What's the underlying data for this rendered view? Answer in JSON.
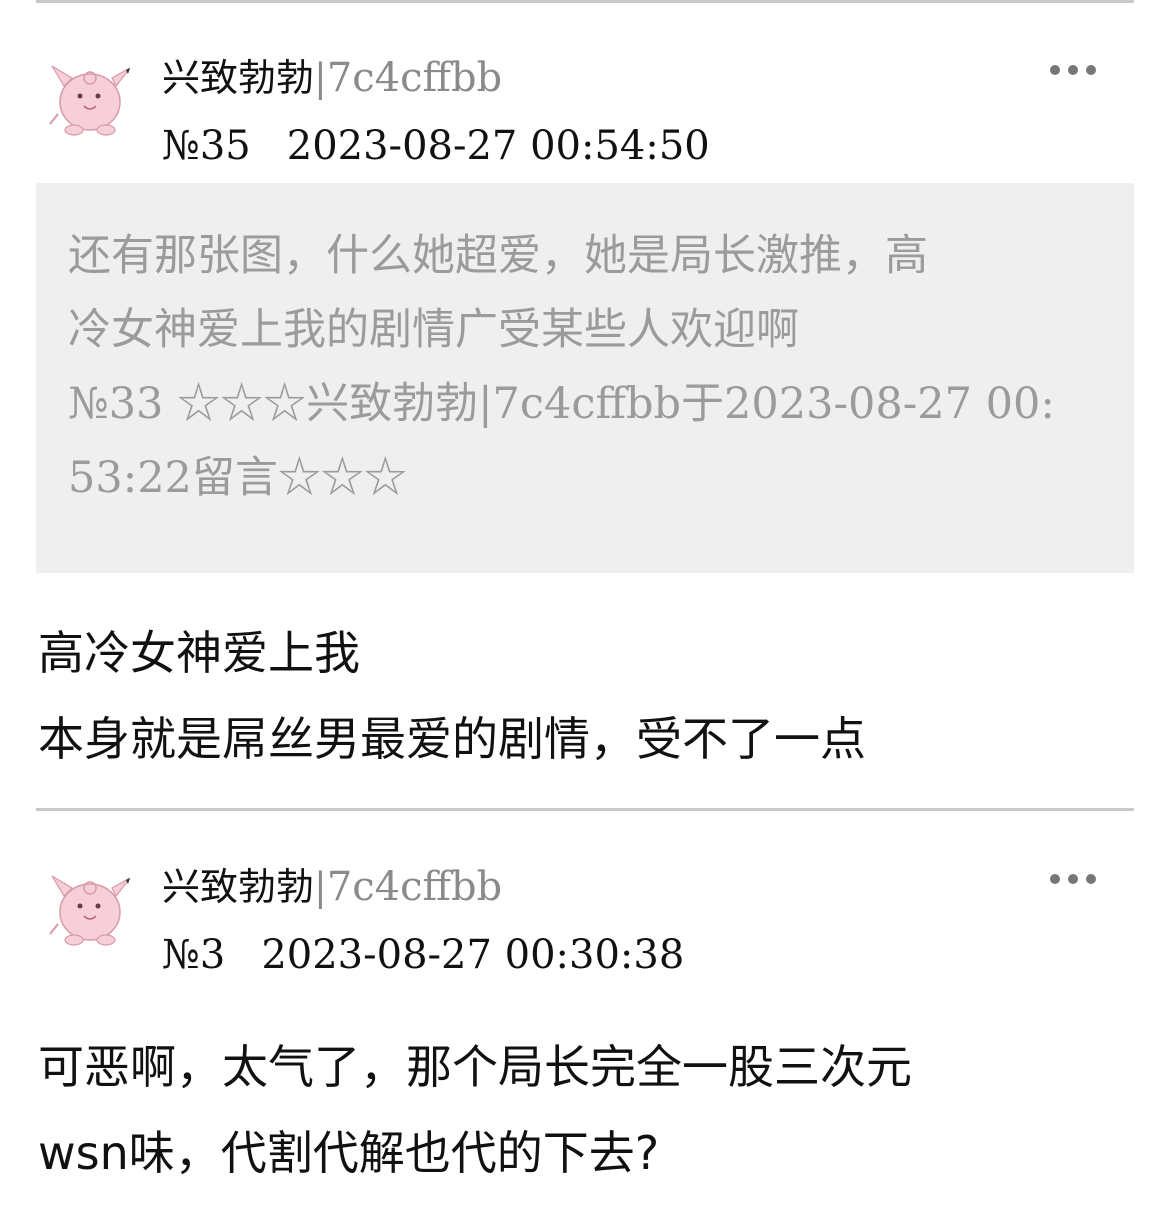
{
  "posts": [
    {
      "nickname": "兴致勃勃",
      "separator": "|",
      "user_id": "7c4cffbb",
      "floor": "№35",
      "timestamp": "2023-08-27 00:54:50",
      "more_icon": "more-dots-icon",
      "quote": {
        "text_line1": "还有那张图，什么她超爱，她是局长激推，高",
        "text_line2": "冷女神爱上我的剧情广受某些人欢迎啊",
        "ref_line1": "№33 ☆☆☆兴致勃勃|7c4cffbb于2023-08-27 00:",
        "ref_line2": "53:22留言☆☆☆"
      },
      "body_lines": [
        "高冷女神爱上我",
        "本身就是屌丝男最爱的剧情，受不了一点"
      ]
    },
    {
      "nickname": "兴致勃勃",
      "separator": "|",
      "user_id": "7c4cffbb",
      "floor": "№3",
      "timestamp": "2023-08-27 00:30:38",
      "more_icon": "more-dots-icon",
      "body_lines": [
        "可恶啊，太气了，那个局长完全一股三次元",
        "wsn味，代割代解也代的下去?"
      ]
    }
  ],
  "colors": {
    "divider": "#c9c9c9",
    "quote_bg": "#efefef",
    "quote_text": "#9b9b9b",
    "uid_text": "#8a8a8a",
    "avatar_pink": "#f4c6d0"
  }
}
